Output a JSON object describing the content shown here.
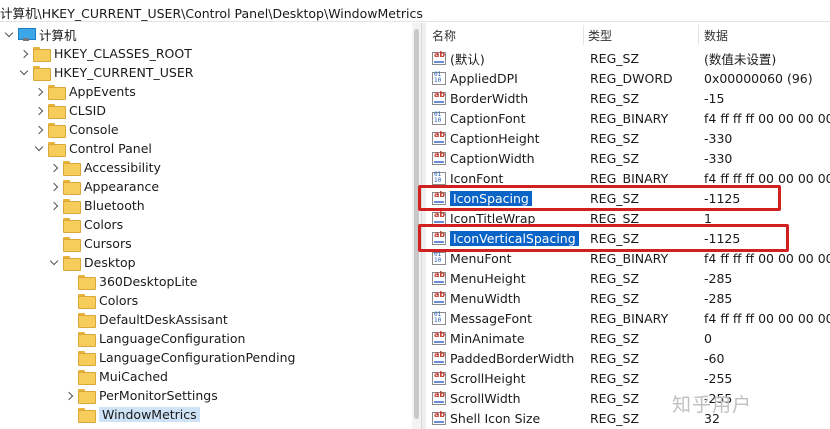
{
  "address": "计算机\\HKEY_CURRENT_USER\\Control Panel\\Desktop\\WindowMetrics",
  "tree": [
    {
      "label": "计算机",
      "icon": "computer-icon",
      "chev": "down",
      "indent": 0
    },
    {
      "label": "HKEY_CLASSES_ROOT",
      "icon": "folder-icon",
      "chev": "right",
      "indent": 1
    },
    {
      "label": "HKEY_CURRENT_USER",
      "icon": "folder-icon",
      "chev": "down",
      "indent": 1
    },
    {
      "label": "AppEvents",
      "icon": "folder-icon",
      "chev": "right",
      "indent": 2
    },
    {
      "label": "CLSID",
      "icon": "folder-icon",
      "chev": "right",
      "indent": 2
    },
    {
      "label": "Console",
      "icon": "folder-icon",
      "chev": "right",
      "indent": 2
    },
    {
      "label": "Control Panel",
      "icon": "folder-icon",
      "chev": "down",
      "indent": 2
    },
    {
      "label": "Accessibility",
      "icon": "folder-icon",
      "chev": "right",
      "indent": 3
    },
    {
      "label": "Appearance",
      "icon": "folder-icon",
      "chev": "right",
      "indent": 3
    },
    {
      "label": "Bluetooth",
      "icon": "folder-icon",
      "chev": "right",
      "indent": 3
    },
    {
      "label": "Colors",
      "icon": "folder-icon",
      "chev": "none",
      "indent": 3
    },
    {
      "label": "Cursors",
      "icon": "folder-icon",
      "chev": "none",
      "indent": 3
    },
    {
      "label": "Desktop",
      "icon": "folder-icon",
      "chev": "down",
      "indent": 3
    },
    {
      "label": "360DesktopLite",
      "icon": "folder-icon",
      "chev": "none",
      "indent": 4
    },
    {
      "label": "Colors",
      "icon": "folder-icon",
      "chev": "none",
      "indent": 4
    },
    {
      "label": "DefaultDeskAssisant",
      "icon": "folder-icon",
      "chev": "none",
      "indent": 4
    },
    {
      "label": "LanguageConfiguration",
      "icon": "folder-icon",
      "chev": "none",
      "indent": 4
    },
    {
      "label": "LanguageConfigurationPending",
      "icon": "folder-icon",
      "chev": "none",
      "indent": 4
    },
    {
      "label": "MuiCached",
      "icon": "folder-icon",
      "chev": "none",
      "indent": 4
    },
    {
      "label": "PerMonitorSettings",
      "icon": "folder-icon",
      "chev": "right",
      "indent": 4
    },
    {
      "label": "WindowMetrics",
      "icon": "folder-icon",
      "chev": "none",
      "indent": 4,
      "selected": true
    }
  ],
  "list": {
    "headers": {
      "name": "名称",
      "type": "类型",
      "data": "数据"
    },
    "rows": [
      {
        "name": "(默认)",
        "type": "REG_SZ",
        "data": "(数值未设置)",
        "kind": "sz"
      },
      {
        "name": "AppliedDPI",
        "type": "REG_DWORD",
        "data": "0x00000060 (96)",
        "kind": "bin"
      },
      {
        "name": "BorderWidth",
        "type": "REG_SZ",
        "data": "-15",
        "kind": "sz"
      },
      {
        "name": "CaptionFont",
        "type": "REG_BINARY",
        "data": "f4 ff ff ff 00 00 00 00 00",
        "kind": "bin"
      },
      {
        "name": "CaptionHeight",
        "type": "REG_SZ",
        "data": "-330",
        "kind": "sz"
      },
      {
        "name": "CaptionWidth",
        "type": "REG_SZ",
        "data": "-330",
        "kind": "sz"
      },
      {
        "name": "IconFont",
        "type": "REG_BINARY",
        "data": "f4 ff ff ff 00 00 00 00 00",
        "kind": "bin"
      },
      {
        "name": "IconSpacing",
        "type": "REG_SZ",
        "data": "-1125",
        "kind": "sz",
        "selected": true
      },
      {
        "name": "IconTitleWrap",
        "type": "REG_SZ",
        "data": "1",
        "kind": "sz"
      },
      {
        "name": "IconVerticalSpacing",
        "type": "REG_SZ",
        "data": "-1125",
        "kind": "sz",
        "selected": true
      },
      {
        "name": "MenuFont",
        "type": "REG_BINARY",
        "data": "f4 ff ff ff 00 00 00 00 00",
        "kind": "bin"
      },
      {
        "name": "MenuHeight",
        "type": "REG_SZ",
        "data": "-285",
        "kind": "sz"
      },
      {
        "name": "MenuWidth",
        "type": "REG_SZ",
        "data": "-285",
        "kind": "sz"
      },
      {
        "name": "MessageFont",
        "type": "REG_BINARY",
        "data": "f4 ff ff ff 00 00 00 00 00",
        "kind": "bin"
      },
      {
        "name": "MinAnimate",
        "type": "REG_SZ",
        "data": "0",
        "kind": "sz"
      },
      {
        "name": "PaddedBorderWidth",
        "type": "REG_SZ",
        "data": "-60",
        "kind": "sz"
      },
      {
        "name": "ScrollHeight",
        "type": "REG_SZ",
        "data": "-255",
        "kind": "sz"
      },
      {
        "name": "ScrollWidth",
        "type": "REG_SZ",
        "data": "-255",
        "kind": "sz"
      },
      {
        "name": "Shell Icon Size",
        "type": "REG_SZ",
        "data": "32",
        "kind": "sz"
      }
    ]
  },
  "watermark": "知乎用户",
  "colors": {
    "highlight_box": "#d21f1f",
    "selection": "#0a64c8"
  }
}
